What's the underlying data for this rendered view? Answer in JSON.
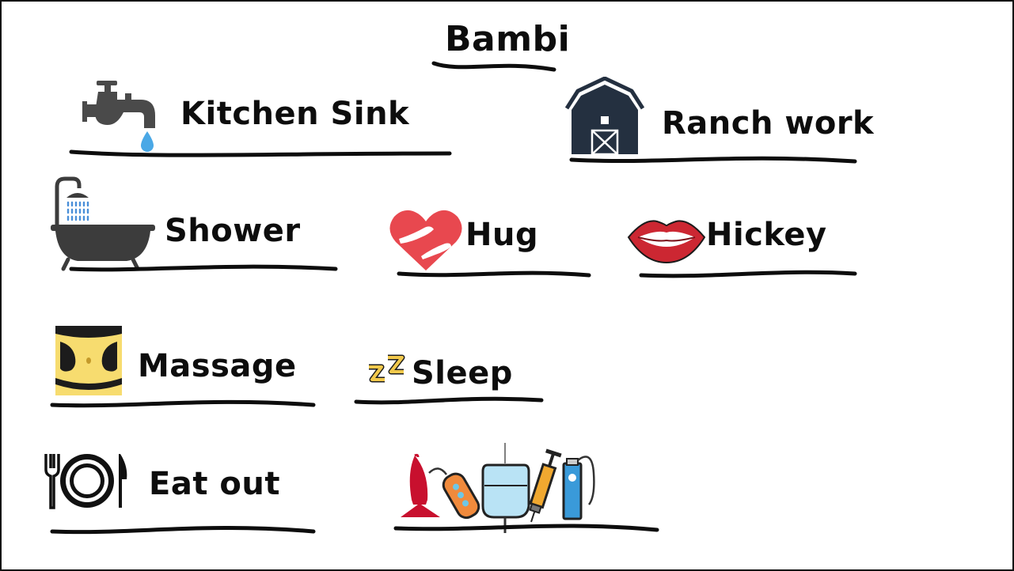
{
  "title": "Bambi",
  "items": [
    {
      "label": "Kitchen Sink",
      "icon": "faucet-icon"
    },
    {
      "label": "Ranch work",
      "icon": "barn-icon"
    },
    {
      "label": "Shower",
      "icon": "bathtub-shower-icon"
    },
    {
      "label": "Hug",
      "icon": "heart-hug-icon"
    },
    {
      "label": "Hickey",
      "icon": "lips-icon"
    },
    {
      "label": "Massage",
      "icon": "massage-icon"
    },
    {
      "label": "Sleep",
      "icon": "zz-sleep-icon"
    },
    {
      "label": "Eat out",
      "icon": "plate-cutlery-icon"
    },
    {
      "label": "",
      "icon": "toys-icons"
    }
  ],
  "colors": {
    "ink": "#0d0d0d",
    "faucet": "#4a4a4a",
    "water": "#4aa8e6",
    "barn": "#243040",
    "heart": "#e8484f",
    "lips": "#cc2732",
    "skin": "#f7dc6f",
    "zz": "#f2c94c"
  }
}
